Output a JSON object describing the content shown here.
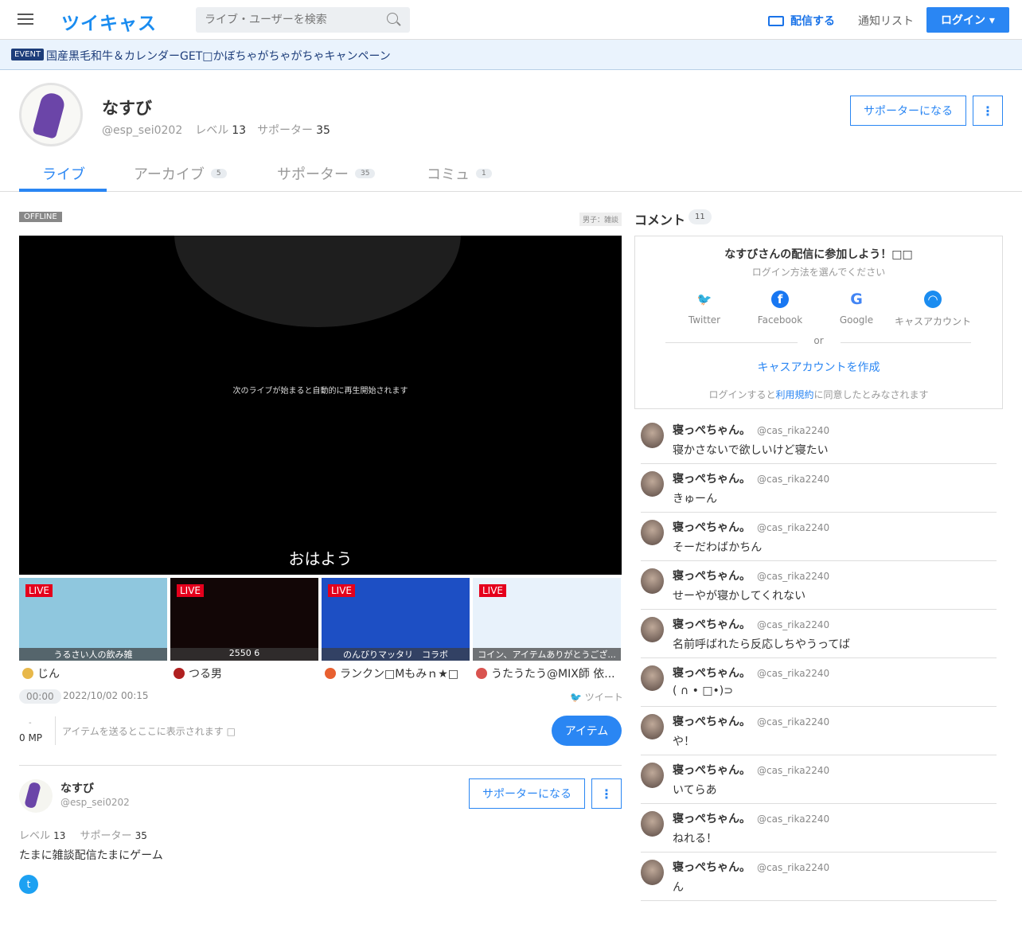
{
  "header": {
    "logo": "ツイキャス",
    "search_placeholder": "ライブ・ユーザーを検索",
    "broadcast": "配信する",
    "notify": "通知リスト",
    "login": "ログイン ▾"
  },
  "event": {
    "badge": "EVENT",
    "text": "国産黒毛和牛＆カレンダーGET□かぼちゃがちゃがちゃキャンペーン"
  },
  "profile": {
    "name": "なすび",
    "id": "@esp_sei0202",
    "level_label": "レベル",
    "level": "13",
    "supporter_label": "サポーター",
    "supporters": "35",
    "support_btn": "サポーターになる",
    "more": "⋮",
    "bio": "たまに雑談配信たまにゲーム"
  },
  "tabs": [
    {
      "label": "ライブ",
      "count": ""
    },
    {
      "label": "アーカイブ",
      "count": "5"
    },
    {
      "label": "サポーター",
      "count": "35"
    },
    {
      "label": "コミュ",
      "count": "1"
    }
  ],
  "live": {
    "status": "OFFLINE",
    "genre": "男子：雑談",
    "message": "次のライブが始まると自動的に再生開始されます",
    "title": "おはよう",
    "elapsed": "00:00",
    "date": "2022/10/02 00:15",
    "tweet": "ツイート",
    "mp_dash": "-",
    "mp": "0 MP",
    "item_msg": "アイテムを送るとここに表示されます □",
    "item_btn": "アイテム"
  },
  "thumbs": [
    {
      "badge": "LIVE",
      "caption": "うるさい人の飲み雑",
      "user": "じん",
      "bg": "#8fc7de",
      "dot": "#e8b84a"
    },
    {
      "badge": "LIVE",
      "caption": "2550 6",
      "user": "つる男",
      "bg": "#120606",
      "dot": "#b02020"
    },
    {
      "badge": "LIVE",
      "caption": "のんびりマッタリ　コラボ",
      "user": "ランクン□Mもみｎ★□",
      "bg": "#1d4fc4",
      "dot": "#e86030"
    },
    {
      "badge": "LIVE",
      "caption": "コイン、アイテムありがとうござ...",
      "user": "うたうたう@MIX師 依...",
      "bg": "#e8f2fb",
      "dot": "#d9534f"
    }
  ],
  "comments_panel": {
    "title": "コメント",
    "count": "11",
    "join": "なすびさんの配信に参加しよう！□□",
    "choose": "ログイン方法を選んでください",
    "providers": [
      "Twitter",
      "Facebook",
      "Google",
      "キャスアカウント"
    ],
    "or": "or",
    "create": "キャスアカウントを作成",
    "terms_pre": "ログインすると",
    "terms_link": "利用規約",
    "terms_post": "に同意したとみなされます"
  },
  "comments": [
    {
      "name": "寝っぺちゃん。",
      "id": "@cas_rika2240",
      "text": "寝かさないで欲しいけど寝たい"
    },
    {
      "name": "寝っぺちゃん。",
      "id": "@cas_rika2240",
      "text": "きゅーん"
    },
    {
      "name": "寝っぺちゃん。",
      "id": "@cas_rika2240",
      "text": "そーだわばかちん"
    },
    {
      "name": "寝っぺちゃん。",
      "id": "@cas_rika2240",
      "text": "せーやが寝かしてくれない"
    },
    {
      "name": "寝っぺちゃん。",
      "id": "@cas_rika2240",
      "text": "名前呼ばれたら反応しちやうってば"
    },
    {
      "name": "寝っぺちゃん。",
      "id": "@cas_rika2240",
      "text": "( ∩ • □•)⊃"
    },
    {
      "name": "寝っぺちゃん。",
      "id": "@cas_rika2240",
      "text": "や！"
    },
    {
      "name": "寝っぺちゃん。",
      "id": "@cas_rika2240",
      "text": "いてらあ"
    },
    {
      "name": "寝っぺちゃん。",
      "id": "@cas_rika2240",
      "text": "ねれる！"
    },
    {
      "name": "寝っぺちゃん。",
      "id": "@cas_rika2240",
      "text": "ん"
    }
  ]
}
